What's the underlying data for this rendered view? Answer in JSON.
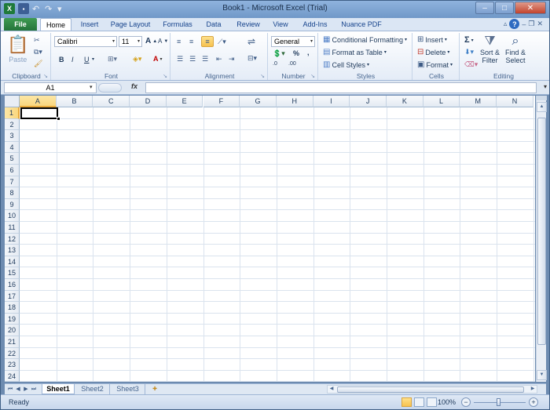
{
  "title_bar": {
    "title": "Book1 - Microsoft Excel (Trial)",
    "qat_icons": [
      "excel-app-icon",
      "save-icon",
      "undo-icon",
      "redo-icon",
      "customize-qat-icon"
    ],
    "window_controls": [
      "minimize",
      "maximize",
      "close"
    ]
  },
  "tabs": {
    "file": "File",
    "items": [
      "Home",
      "Insert",
      "Page Layout",
      "Formulas",
      "Data",
      "Review",
      "View",
      "Add-Ins",
      "Nuance PDF"
    ],
    "active": "Home"
  },
  "ribbon": {
    "clipboard": {
      "label": "Clipboard",
      "paste": "Paste"
    },
    "font": {
      "label": "Font",
      "font_name": "Calibri",
      "font_size": "11",
      "bold": "B",
      "italic": "I",
      "underline": "U",
      "grow": "A",
      "shrink": "A",
      "font_color": "A"
    },
    "alignment": {
      "label": "Alignment"
    },
    "number": {
      "label": "Number",
      "format": "General",
      "percent": "%",
      "comma": ",",
      "increase_decimal": ".0",
      "decrease_decimal": ".00"
    },
    "styles": {
      "label": "Styles",
      "conditional_formatting": "Conditional Formatting",
      "format_as_table": "Format as Table",
      "cell_styles": "Cell Styles"
    },
    "cells": {
      "label": "Cells",
      "insert": "Insert",
      "delete": "Delete",
      "format": "Format"
    },
    "editing": {
      "label": "Editing",
      "sum": "Σ",
      "sort_filter_line1": "Sort &",
      "sort_filter_line2": "Filter",
      "find_select_line1": "Find &",
      "find_select_line2": "Select"
    }
  },
  "formula_bar": {
    "name_box": "A1",
    "fx": "fx",
    "formula": ""
  },
  "grid": {
    "columns": [
      "A",
      "B",
      "C",
      "D",
      "E",
      "F",
      "G",
      "H",
      "I",
      "J",
      "K",
      "L",
      "M",
      "N"
    ],
    "rows": [
      "1",
      "2",
      "3",
      "4",
      "5",
      "6",
      "7",
      "8",
      "9",
      "10",
      "11",
      "12",
      "13",
      "14",
      "15",
      "16",
      "17",
      "18",
      "19",
      "20",
      "21",
      "22",
      "23",
      "24"
    ],
    "selected_cell": "A1"
  },
  "sheets": {
    "tabs": [
      "Sheet1",
      "Sheet2",
      "Sheet3"
    ],
    "active": "Sheet1"
  },
  "status_bar": {
    "status": "Ready",
    "zoom": "100%",
    "zoom_out": "−",
    "zoom_in": "+"
  },
  "colors": {
    "file_tab": "#24743a",
    "selection_header": "#f9d77e",
    "ribbon_bg": "#e4ecf7",
    "accent": "#15428b"
  }
}
